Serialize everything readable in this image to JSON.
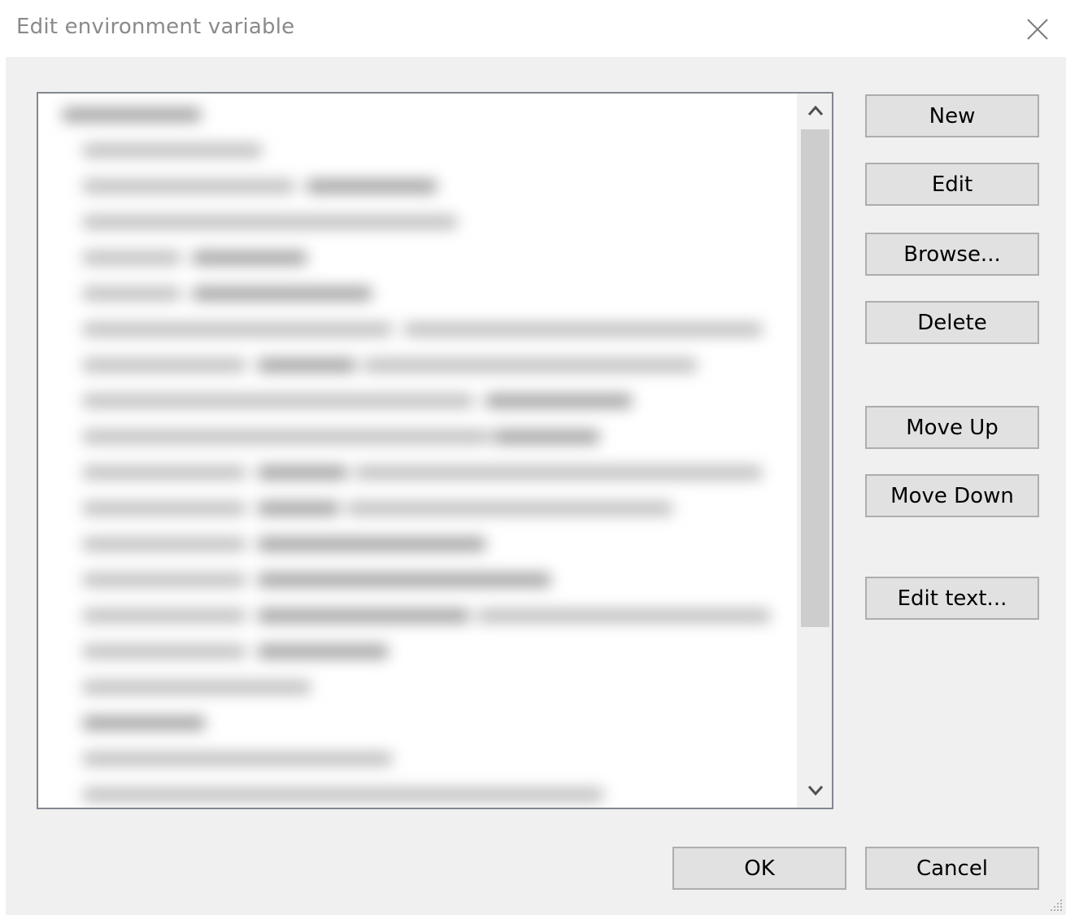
{
  "window": {
    "title": "Edit environment variable"
  },
  "list": {
    "rows": 20,
    "note": ""
  },
  "side_buttons": {
    "new": "New",
    "edit": "Edit",
    "browse": "Browse...",
    "delete": "Delete",
    "move_up": "Move Up",
    "move_down": "Move Down",
    "edit_text": "Edit text..."
  },
  "footer_buttons": {
    "ok": "OK",
    "cancel": "Cancel"
  },
  "icons": {
    "close": "close-icon",
    "scroll_up": "chevron-up-icon",
    "scroll_down": "chevron-down-icon",
    "resize": "resize-grip-icon"
  },
  "colors": {
    "dialog_background": "#f0f0f0",
    "button_face": "#e1e1e1",
    "button_border": "#adadad",
    "scroll_thumb": "#cdcdcd"
  }
}
